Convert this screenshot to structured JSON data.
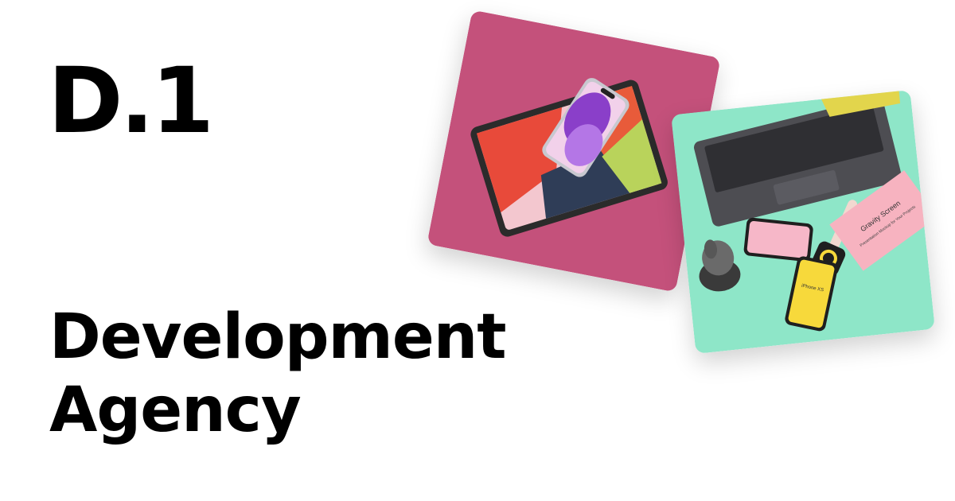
{
  "brand": {
    "logo_text": "D.1"
  },
  "headline": {
    "line1": "Development",
    "line2": "Agency"
  },
  "colors": {
    "card1": "#c4517b",
    "card2": "#8ee6c8",
    "text": "#000000"
  },
  "mockups": {
    "card2": {
      "pink_card_title": "Gravity Screen",
      "pink_card_subtitle": "Presentation Mockup for Your Projects",
      "phone_label": "iPhone XS"
    }
  }
}
